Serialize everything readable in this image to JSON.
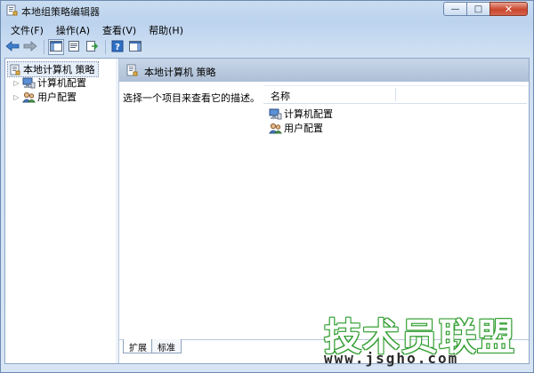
{
  "window": {
    "title": "本地组策略编辑器"
  },
  "menu": {
    "items": [
      "文件(F)",
      "操作(A)",
      "查看(V)",
      "帮助(H)"
    ]
  },
  "toolbar": {
    "buttons": [
      "back-arrow-icon",
      "forward-arrow-icon",
      "show-hide-tree-icon",
      "properties-icon",
      "export-list-icon",
      "help-icon",
      "show-hide-action-pane-icon"
    ]
  },
  "tree": {
    "root_label": "本地计算机 策略",
    "items": [
      {
        "label": "计算机配置",
        "icon": "computer-config-icon"
      },
      {
        "label": "用户配置",
        "icon": "user-config-icon"
      }
    ]
  },
  "main": {
    "header_title": "本地计算机 策略",
    "description": "选择一个项目来查看它的描述。",
    "list": {
      "column_name": "名称",
      "items": [
        {
          "label": "计算机配置"
        },
        {
          "label": "用户配置"
        }
      ]
    },
    "tabs": [
      "扩展",
      "标准"
    ]
  },
  "watermark": {
    "text": "技术员联盟",
    "url": "www.jsgho.com"
  },
  "colors": {
    "accent_green": "#2a9b2a",
    "header_blue": "#aebfd6"
  }
}
